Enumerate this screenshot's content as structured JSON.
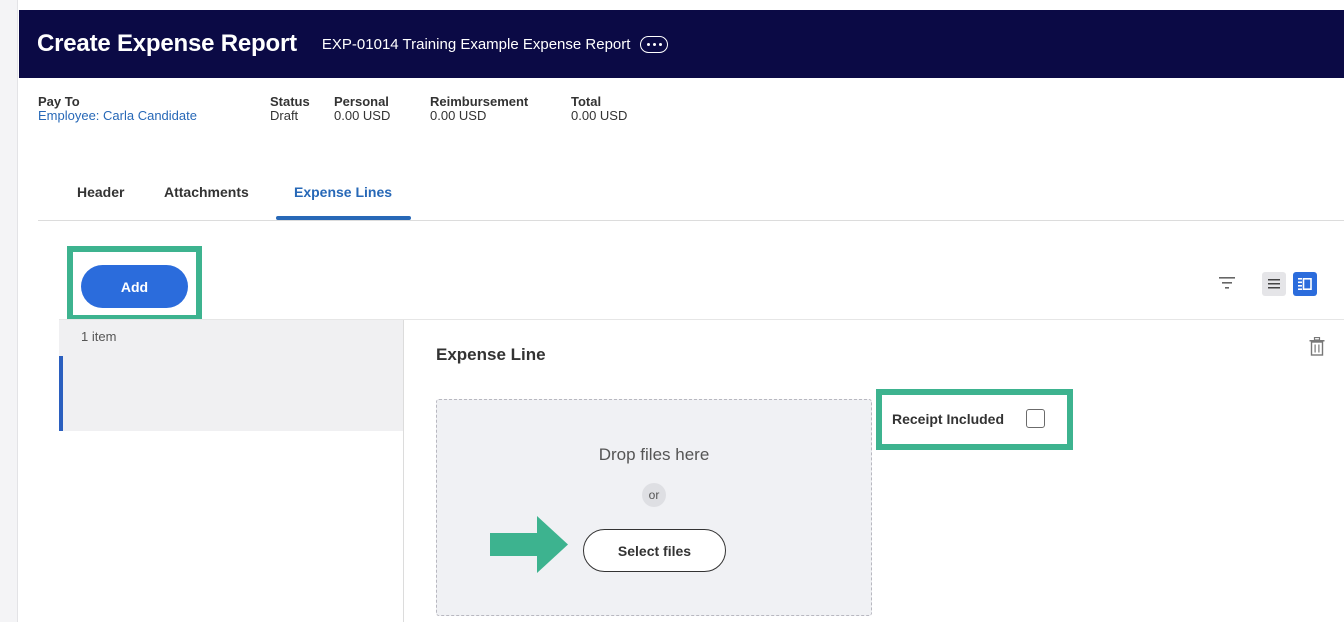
{
  "header": {
    "title": "Create Expense Report",
    "subtitle": "EXP-01014 Training Example Expense Report",
    "more_icon": "ellipsis-icon"
  },
  "summary": {
    "pay_to": {
      "label": "Pay To",
      "value": "Employee: Carla Candidate"
    },
    "status": {
      "label": "Status",
      "value": "Draft"
    },
    "personal": {
      "label": "Personal",
      "value": "0.00 USD"
    },
    "reimbursement": {
      "label": "Reimbursement",
      "value": "0.00 USD"
    },
    "total": {
      "label": "Total",
      "value": "0.00 USD"
    }
  },
  "tabs": [
    {
      "label": "Header"
    },
    {
      "label": "Attachments"
    },
    {
      "label": "Expense Lines",
      "active": true
    }
  ],
  "toolbar": {
    "add_label": "Add",
    "filter_icon": "filter-icon",
    "list_view_icon": "list-view-icon",
    "detail_view_icon": "detail-view-icon"
  },
  "list": {
    "count_label": "1 item"
  },
  "expense_line": {
    "title": "Expense Line",
    "delete_icon": "trash-icon",
    "drop_text": "Drop files here",
    "or_text": "or",
    "select_files_label": "Select files",
    "receipt_label": "Receipt Included",
    "receipt_checked": false
  },
  "colors": {
    "header_bg": "#0b0a45",
    "accent_blue": "#2b6cdc",
    "link_blue": "#2768b7",
    "highlight_green": "#3db38f"
  }
}
